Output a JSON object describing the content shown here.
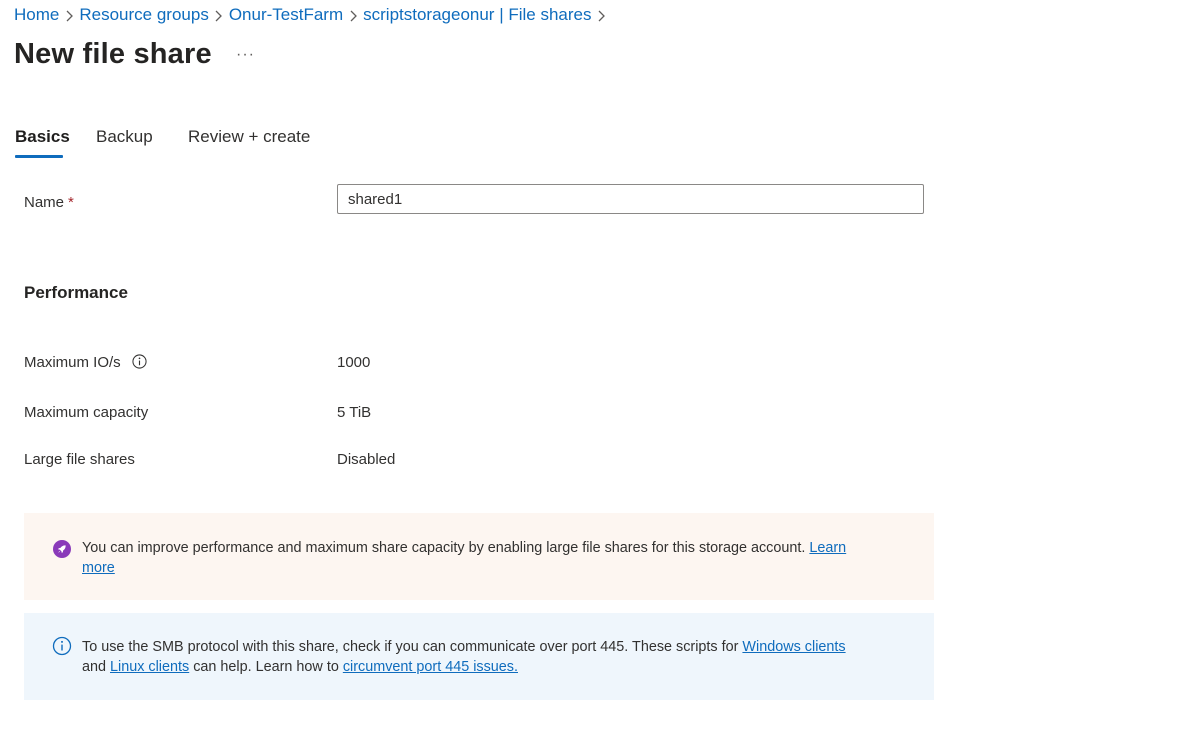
{
  "breadcrumb": {
    "items": [
      "Home",
      "Resource groups",
      "Onur-TestFarm",
      "scriptstorageonur | File shares"
    ]
  },
  "page": {
    "title": "New file share",
    "more": "···"
  },
  "tabs": [
    {
      "label": "Basics",
      "active": true
    },
    {
      "label": "Backup",
      "active": false
    },
    {
      "label": "Review + create",
      "active": false
    }
  ],
  "form": {
    "name_label": "Name",
    "required_marker": "*",
    "name_value": "shared1"
  },
  "performance": {
    "heading": "Performance",
    "rows": [
      {
        "label": "Maximum IO/s",
        "value": "1000",
        "info_icon": "info-icon"
      },
      {
        "label": "Maximum capacity",
        "value": "5 TiB"
      },
      {
        "label": "Large file shares",
        "value": "Disabled"
      }
    ]
  },
  "banners": {
    "warning": {
      "icon": "rocket-icon",
      "text": "You can improve performance and maximum share capacity by enabling large file shares for this storage account.",
      "link": "Learn more"
    },
    "info": {
      "icon": "info-icon",
      "text_1": "To use the SMB protocol with this share, check if you can communicate over port 445. These scripts for",
      "link_windows": "Windows clients",
      "text_2": "and",
      "link_linux": "Linux clients",
      "text_3": "can help. Learn how to",
      "link_circumvent": "circumvent port 445 issues."
    }
  },
  "colors": {
    "link": "#0f6cbd",
    "warning_bg": "#fdf6f1",
    "info_bg": "#eff6fc",
    "rocket": "#8a3ab9",
    "required": "#a4262c"
  }
}
